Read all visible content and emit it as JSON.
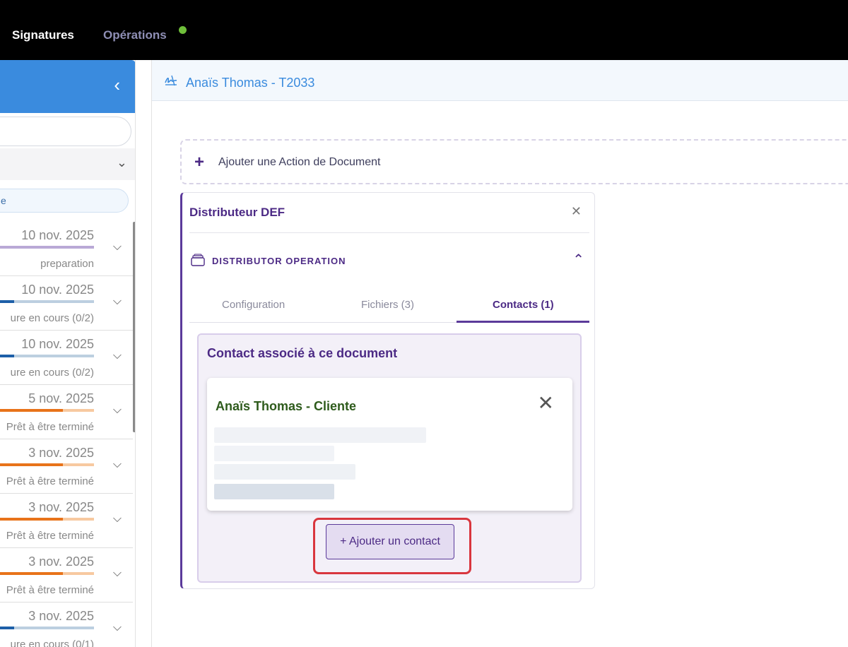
{
  "topnav": {
    "items": [
      {
        "label": "Signatures"
      },
      {
        "label": "Opérations"
      }
    ],
    "status_color": "#6fbf3a"
  },
  "sidebar": {
    "collapse_icon": "chevron-left-icon",
    "filter_text": "e",
    "items": [
      {
        "date": "10 nov. 2025",
        "status": "preparation",
        "progress": 0.0,
        "bar_color": "#b9a9d6"
      },
      {
        "date": "10 nov. 2025",
        "status": "ure en cours (0/2)",
        "progress": 0.15,
        "bar_color": "#1d5fa8"
      },
      {
        "date": "10 nov. 2025",
        "status": "ure en cours (0/2)",
        "progress": 0.15,
        "bar_color": "#1d5fa8"
      },
      {
        "date": "5 nov. 2025",
        "status": "Prêt à être terminé",
        "progress": 0.67,
        "bar_color": "#e8731a"
      },
      {
        "date": "3 nov. 2025",
        "status": "Prêt à être terminé",
        "progress": 0.67,
        "bar_color": "#e8731a"
      },
      {
        "date": "3 nov. 2025",
        "status": "Prêt à être terminé",
        "progress": 0.67,
        "bar_color": "#e8731a"
      },
      {
        "date": "3 nov. 2025",
        "status": "Prêt à être terminé",
        "progress": 0.67,
        "bar_color": "#e8731a"
      },
      {
        "date": "3 nov. 2025",
        "status": "ure en cours (0/1)",
        "progress": 0.15,
        "bar_color": "#1d5fa8"
      }
    ]
  },
  "main": {
    "title": "Anaïs Thomas - T2033",
    "add_action_label": "Ajouter une Action de Document",
    "card": {
      "title": "Distributeur DEF",
      "section_label": "DISTRIBUTOR OPERATION",
      "tabs": [
        {
          "label": "Configuration"
        },
        {
          "label": "Fichiers (3)"
        },
        {
          "label": "Contacts (1)"
        }
      ],
      "active_tab": "Contacts (1)",
      "contacts_title": "Contact associé à ce document",
      "contact_name": "Anaïs Thomas - Cliente",
      "add_contact_label": "+ Ajouter un contact"
    }
  },
  "colors": {
    "accent": "#4c2a85",
    "header_blue": "#3a8bde",
    "highlight": "#d9363e"
  }
}
